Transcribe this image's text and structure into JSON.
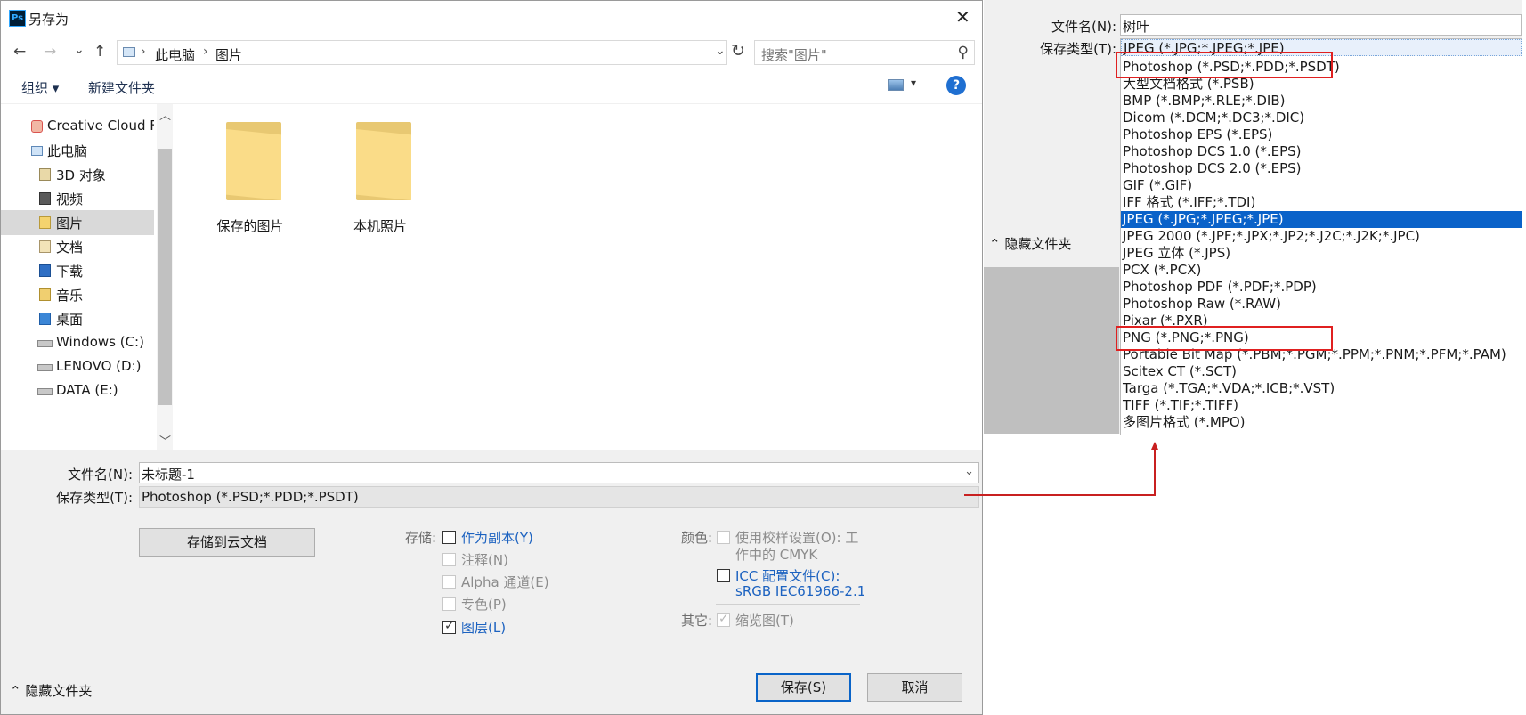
{
  "dialog": {
    "title": "另存为",
    "app_logo": "Ps",
    "close_glyph": "✕"
  },
  "nav": {
    "back": "←",
    "forward": "→",
    "recent": "⌄",
    "up": "↑",
    "breadcrumb": [
      "此电脑",
      "图片"
    ],
    "search_placeholder": "搜索\"图片\"",
    "refresh": "↻",
    "search_icon": "⚲"
  },
  "toolbar": {
    "organize": "组织 ▾",
    "new_folder": "新建文件夹",
    "help": "?"
  },
  "sidebar": {
    "items": [
      {
        "label": "Creative Cloud Files",
        "icon": "creative-cloud-icon"
      },
      {
        "label": "此电脑",
        "icon": "computer-icon"
      },
      {
        "label": "3D 对象",
        "icon": "3d-objects-icon"
      },
      {
        "label": "视频",
        "icon": "video-icon"
      },
      {
        "label": "图片",
        "icon": "pictures-icon"
      },
      {
        "label": "文档",
        "icon": "documents-icon"
      },
      {
        "label": "下载",
        "icon": "download-icon"
      },
      {
        "label": "音乐",
        "icon": "music-icon"
      },
      {
        "label": "桌面",
        "icon": "desktop-icon"
      },
      {
        "label": "Windows (C:)",
        "icon": "drive-icon"
      },
      {
        "label": "LENOVO (D:)",
        "icon": "drive-icon"
      },
      {
        "label": "DATA (E:)",
        "icon": "drive-icon"
      }
    ]
  },
  "files": [
    {
      "label": "保存的图片",
      "icon": "folder-icon"
    },
    {
      "label": "本机照片",
      "icon": "folder-icon"
    }
  ],
  "form": {
    "filename_label": "文件名(N):",
    "filename_value": "未标题-1",
    "filetype_label": "保存类型(T):",
    "filetype_value": "Photoshop (*.PSD;*.PDD;*.PSDT)",
    "cloud_button": "存储到云文档"
  },
  "options": {
    "storage_label": "存储:",
    "as_copy": "作为副本(Y)",
    "notes": "注释(N)",
    "alpha": "Alpha 通道(E)",
    "spot": "专色(P)",
    "layers": "图层(L)",
    "color_label": "颜色:",
    "proof_line1": "使用校样设置(O): 工",
    "proof_line2": "作中的 CMYK",
    "icc_line1": "ICC 配置文件(C):",
    "icc_line2": "sRGB IEC61966-2.1",
    "other_label": "其它:",
    "thumbnail": "缩览图(T)"
  },
  "footer": {
    "hide_folders": "隐藏文件夹",
    "hide_glyph": "⌃",
    "save": "保存(S)",
    "cancel": "取消"
  },
  "right_panel": {
    "filename_label": "文件名(N):",
    "filename_value": "树叶",
    "filetype_label": "保存类型(T):",
    "hide_folders": "隐藏文件夹",
    "formats": [
      "JPEG (*.JPG;*.JPEG;*.JPE)",
      "Photoshop (*.PSD;*.PDD;*.PSDT)",
      "大型文档格式 (*.PSB)",
      "BMP (*.BMP;*.RLE;*.DIB)",
      "Dicom (*.DCM;*.DC3;*.DIC)",
      "Photoshop EPS (*.EPS)",
      "Photoshop DCS 1.0 (*.EPS)",
      "Photoshop DCS 2.0 (*.EPS)",
      "GIF (*.GIF)",
      "IFF 格式 (*.IFF;*.TDI)",
      "JPEG (*.JPG;*.JPEG;*.JPE)",
      "JPEG 2000 (*.JPF;*.JPX;*.JP2;*.J2C;*.J2K;*.JPC)",
      "JPEG 立体 (*.JPS)",
      "PCX (*.PCX)",
      "Photoshop PDF (*.PDF;*.PDP)",
      "Photoshop Raw (*.RAW)",
      "Pixar (*.PXR)",
      "PNG (*.PNG;*.PNG)",
      "Portable Bit Map (*.PBM;*.PGM;*.PPM;*.PNM;*.PFM;*.PAM)",
      "Scitex CT (*.SCT)",
      "Targa (*.TGA;*.VDA;*.ICB;*.VST)",
      "TIFF (*.TIF;*.TIFF)",
      "多图片格式 (*.MPO)"
    ]
  },
  "colors": {
    "accent": "#0a62c9",
    "annotation_red": "#e02020",
    "link_blue": "#1c62c0"
  }
}
